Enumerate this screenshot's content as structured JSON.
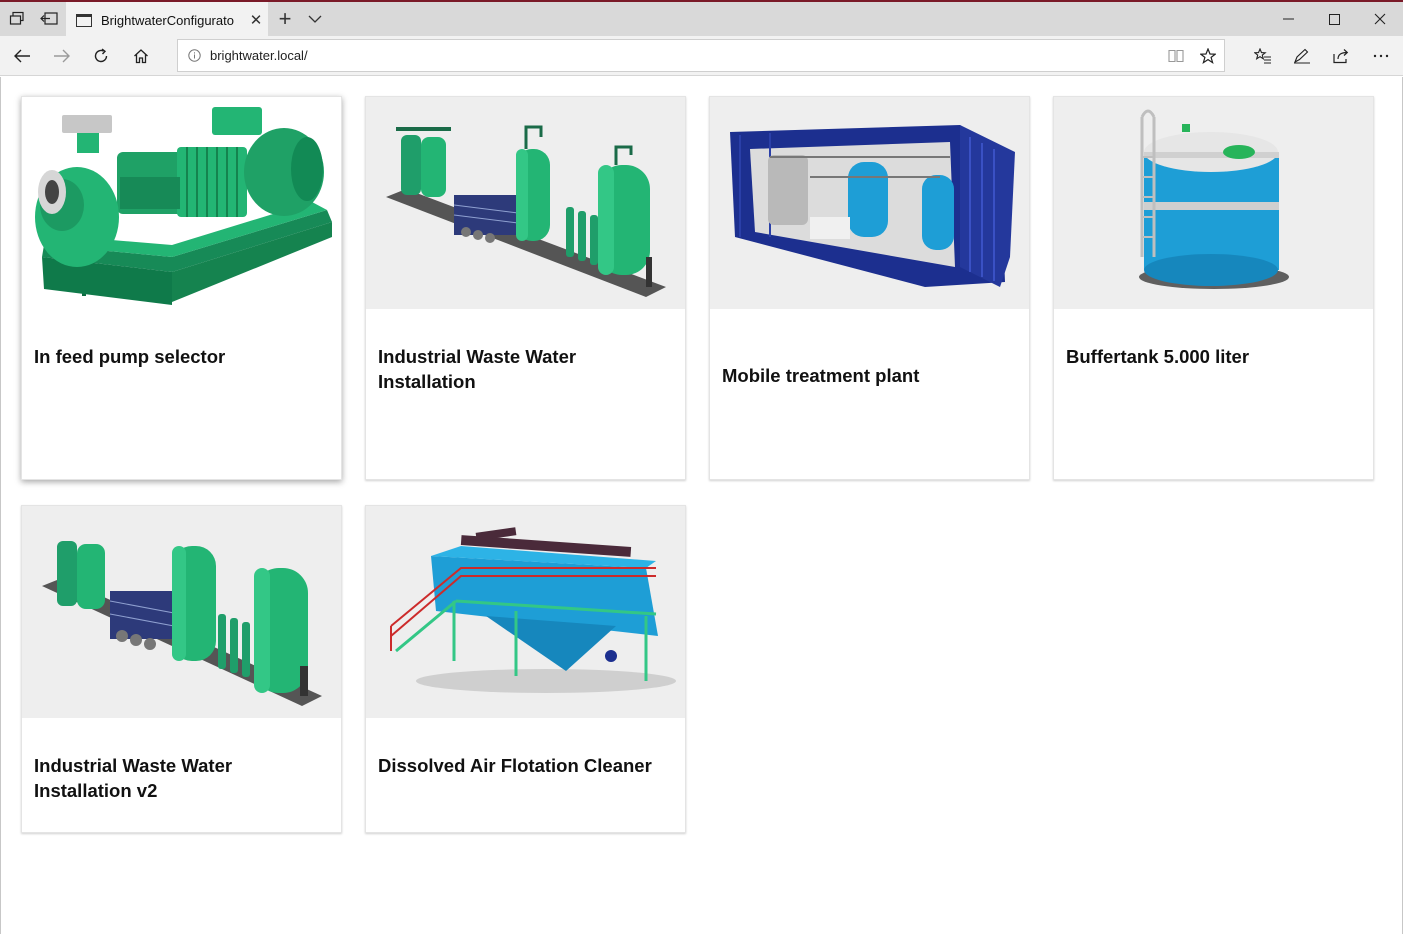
{
  "browser": {
    "tab_title": "BrightwaterConfigurato",
    "new_tab_label": "+",
    "url": "brightwater.local/"
  },
  "icons": {
    "tabs_aside": "tabs-aside-icon",
    "set_aside": "set-aside-icon",
    "page": "page-icon",
    "close": "close-icon",
    "back": "back-arrow-icon",
    "forward": "forward-arrow-icon",
    "refresh": "refresh-icon",
    "home": "home-icon",
    "info": "info-icon",
    "reading_view": "reading-view-icon",
    "favorite": "star-icon",
    "favorites_hub": "favorites-hub-icon",
    "notes": "pen-icon",
    "share": "share-icon",
    "more": "more-icon"
  },
  "cards": [
    {
      "title": "In feed pump selector",
      "image": "green-centrifugal-pump"
    },
    {
      "title": "Industrial Waste Water Installation",
      "image": "green-tank-installation"
    },
    {
      "title": "Mobile treatment plant",
      "image": "blue-container-plant"
    },
    {
      "title": "Buffertank 5.000 liter",
      "image": "blue-buffer-tank"
    },
    {
      "title": "Industrial Waste Water Installation v2",
      "image": "green-tank-installation"
    },
    {
      "title": "Dissolved Air Flotation Cleaner",
      "image": "daf-unit"
    }
  ],
  "colors": {
    "accent_line": "#7a1a28",
    "equipment_green": "#1f9e6a",
    "equipment_blue": "#1e9ed6",
    "container_navy": "#1c2f8f"
  }
}
